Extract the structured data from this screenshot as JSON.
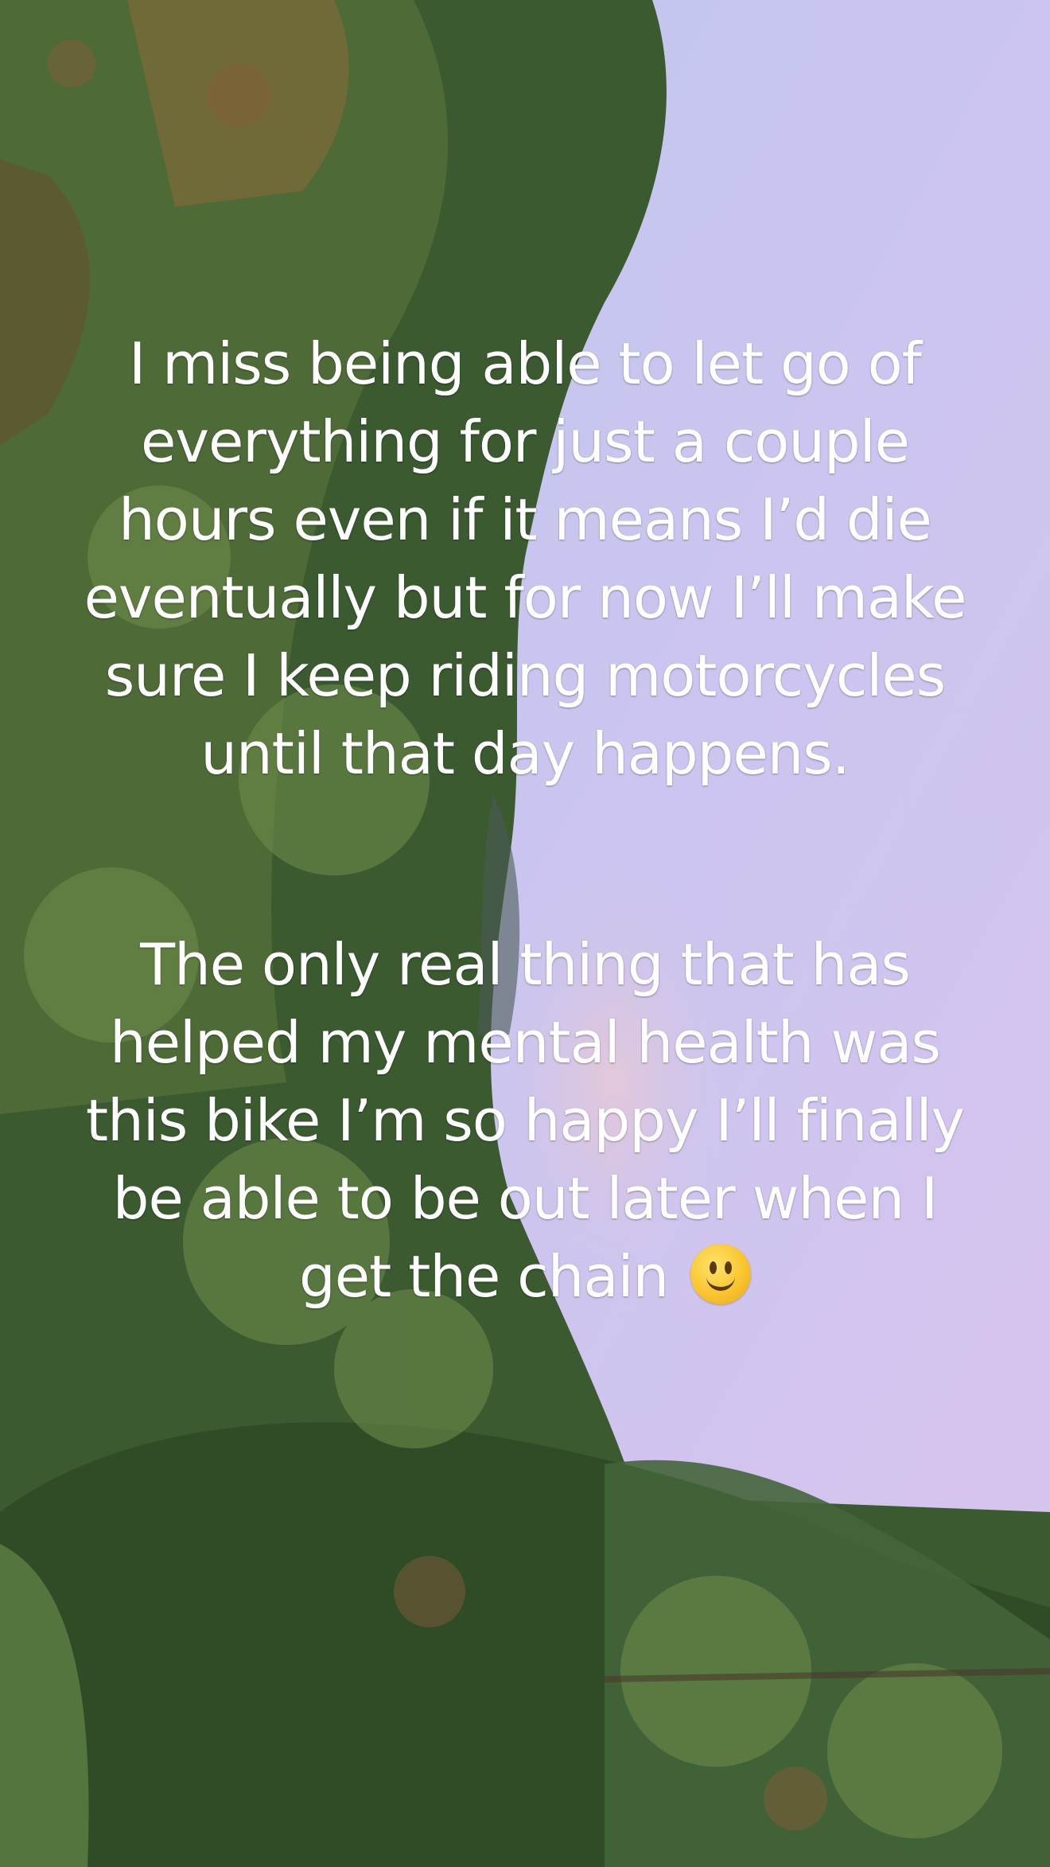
{
  "caption": {
    "paragraph_1": "I miss being able to let go of everything for just a couple hours even if it means I’d die eventually but for now I’ll make sure I keep riding motorcycles until that day happens.",
    "paragraph_2": "The only real thing that has helped my mental health was this bike I’m so happy I’ll finally be able to be out later when I get the chain",
    "emoji": "slightly-smiling-face-icon"
  },
  "colors": {
    "sky": "#cfc8ef",
    "foliage": "#3f6134",
    "text": "#ffffff"
  }
}
